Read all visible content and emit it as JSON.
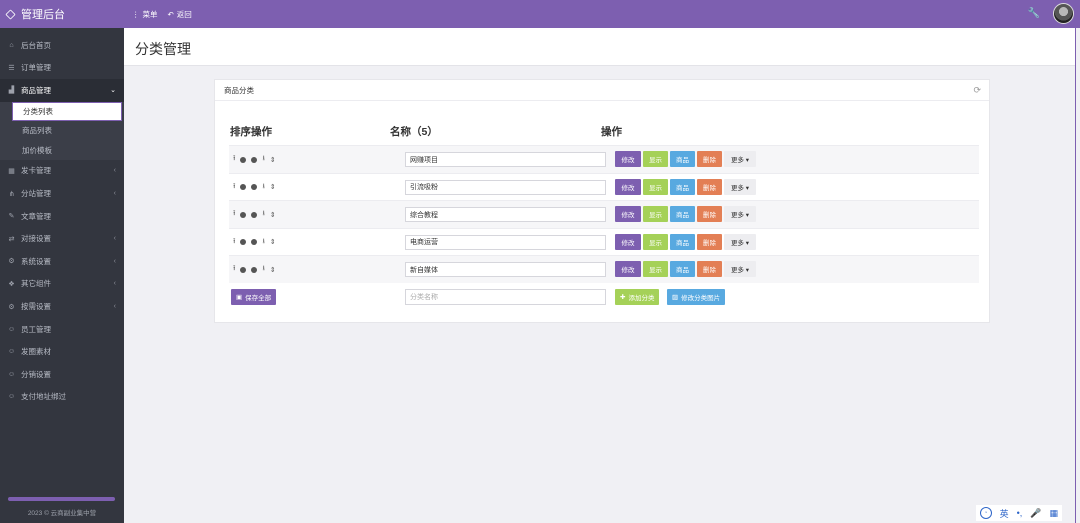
{
  "topbar": {
    "brand": "管理后台",
    "menu_label": "菜单",
    "back_label": "返回"
  },
  "sidebar": {
    "items": [
      {
        "label": "后台首页",
        "icon": "⌂",
        "chevron": ""
      },
      {
        "label": "订单管理",
        "icon": "☰",
        "chevron": ""
      },
      {
        "label": "商品管理",
        "icon": "🛒",
        "chevron": "⌄"
      },
      {
        "label": "发卡管理",
        "icon": "▦",
        "chevron": "‹"
      },
      {
        "label": "分站管理",
        "icon": "⋔",
        "chevron": "‹"
      },
      {
        "label": "文章管理",
        "icon": "✎",
        "chevron": ""
      },
      {
        "label": "对接设置",
        "icon": "⇄",
        "chevron": "‹"
      },
      {
        "label": "系统设置",
        "icon": "⚙",
        "chevron": "‹"
      },
      {
        "label": "其它组件",
        "icon": "❖",
        "chevron": "‹"
      },
      {
        "label": "按需设置",
        "icon": "⚙",
        "chevron": "‹"
      },
      {
        "label": "员工管理",
        "icon": "☺",
        "chevron": ""
      },
      {
        "label": "发圈素材",
        "icon": "☺",
        "chevron": ""
      },
      {
        "label": "分销设置",
        "icon": "☺",
        "chevron": ""
      },
      {
        "label": "支付地址绑过",
        "icon": "☺",
        "chevron": ""
      }
    ],
    "sub_items": [
      {
        "label": "分类列表"
      },
      {
        "label": "商品列表"
      },
      {
        "label": "加价模板"
      }
    ],
    "copyright": "2023 © 云商副业集中营"
  },
  "page": {
    "title": "分类管理"
  },
  "panel": {
    "title": "商品分类",
    "col_sort": "排序操作",
    "col_name": "名称（5）",
    "col_ops": "操作",
    "rows": [
      {
        "name": "网赚项目"
      },
      {
        "name": "引流吸粉"
      },
      {
        "name": "综合教程"
      },
      {
        "name": "电商运营"
      },
      {
        "name": "新自媒体"
      }
    ],
    "btn_edit": "修改",
    "btn_show": "显示",
    "btn_goods": "商品",
    "btn_delete": "删除",
    "btn_more": "更多 ▾",
    "save_all": "保存全部",
    "new_placeholder": "分类名称",
    "add_category": "添加分类",
    "edit_image": "修改分类图片"
  },
  "ime": {
    "lang": "英",
    "punct": "•,",
    "mic": "🎤",
    "grid": "▦"
  }
}
